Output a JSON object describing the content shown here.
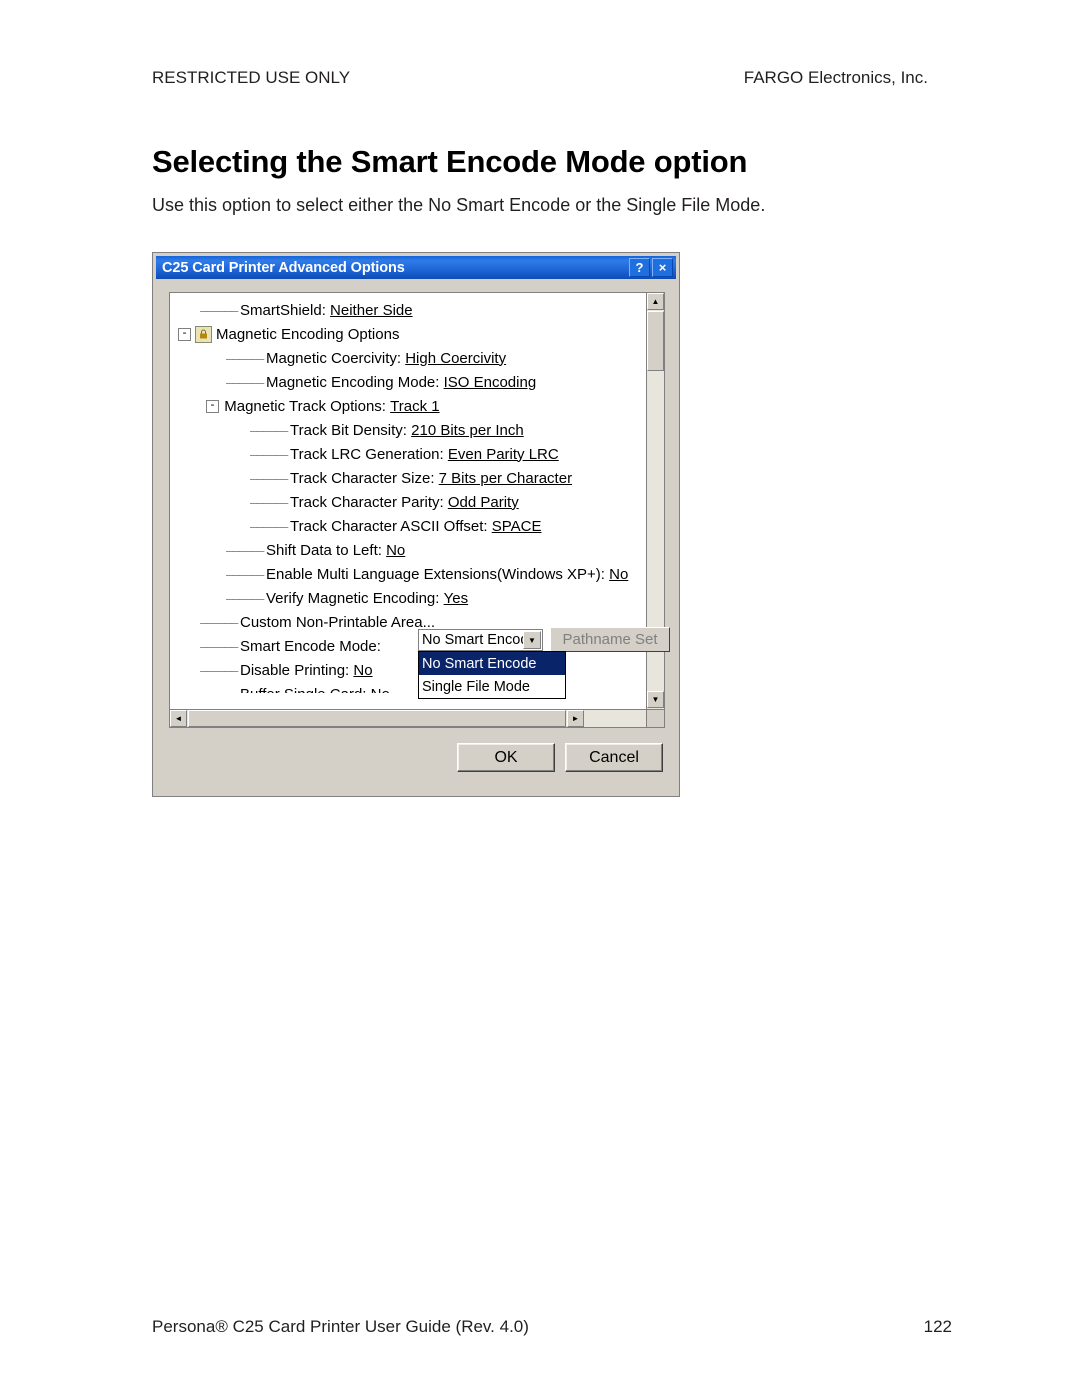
{
  "header": {
    "left": "RESTRICTED USE ONLY",
    "right": "FARGO Electronics, Inc."
  },
  "title": "Selecting the Smart Encode Mode option",
  "intro": "Use this option to select either the No Smart Encode or the Single File Mode.",
  "dialog": {
    "titlebar": "C25 Card Printer Advanced Options",
    "help_button": "?",
    "close_button": "×",
    "tree": [
      {
        "label": "SmartShield:",
        "value": "Neither Side",
        "indent": 30,
        "lead": "dashes",
        "expander": ""
      },
      {
        "label": "Magnetic Encoding Options",
        "value": "",
        "indent": 8,
        "lead": "expander-lock",
        "expander": "-"
      },
      {
        "label": "Magnetic Coercivity:",
        "value": "High Coercivity",
        "indent": 56,
        "lead": "dashes",
        "expander": ""
      },
      {
        "label": "Magnetic Encoding Mode:",
        "value": "ISO Encoding",
        "indent": 56,
        "lead": "dashes",
        "expander": ""
      },
      {
        "label": "Magnetic Track Options:",
        "value": "Track 1",
        "indent": 36,
        "lead": "expander",
        "expander": "-"
      },
      {
        "label": "Track Bit Density:",
        "value": "210 Bits per Inch",
        "indent": 80,
        "lead": "dashes",
        "expander": ""
      },
      {
        "label": "Track LRC Generation:",
        "value": "Even Parity LRC",
        "indent": 80,
        "lead": "dashes",
        "expander": ""
      },
      {
        "label": "Track Character Size:",
        "value": "7 Bits per Character",
        "indent": 80,
        "lead": "dashes",
        "expander": ""
      },
      {
        "label": "Track Character Parity:",
        "value": "Odd Parity",
        "indent": 80,
        "lead": "dashes",
        "expander": ""
      },
      {
        "label": "Track Character ASCII Offset:",
        "value": "SPACE",
        "indent": 80,
        "lead": "dashes",
        "expander": ""
      },
      {
        "label": "Shift Data to Left:",
        "value": "No",
        "indent": 56,
        "lead": "dashes",
        "expander": ""
      },
      {
        "label": "Enable Multi Language Extensions(Windows XP+):",
        "value": "No",
        "indent": 56,
        "lead": "dashes",
        "expander": ""
      },
      {
        "label": "Verify Magnetic Encoding:",
        "value": "Yes",
        "indent": 56,
        "lead": "dashes",
        "expander": ""
      },
      {
        "label": "Custom Non-Printable Area...",
        "value": "",
        "indent": 30,
        "lead": "dashes",
        "expander": ""
      },
      {
        "label": "Smart Encode Mode:",
        "value": "",
        "indent": 30,
        "lead": "dashes",
        "expander": ""
      },
      {
        "label": "Disable Printing:",
        "value": "No",
        "indent": 30,
        "lead": "dashes",
        "expander": ""
      },
      {
        "label": "Buffer Single Card:",
        "value": "No",
        "indent": 30,
        "lead": "dashes",
        "expander": ""
      }
    ],
    "combo": {
      "value": "No Smart Encod",
      "arrow": "▼"
    },
    "dropdown_options": [
      {
        "label": "No Smart Encode",
        "selected": true
      },
      {
        "label": "Single File Mode",
        "selected": false
      }
    ],
    "pathname_button": "Pathname Set",
    "ok_button": "OK",
    "cancel_button": "Cancel",
    "scroll": {
      "up": "▲",
      "down": "▼",
      "left": "◄",
      "right": "►"
    }
  },
  "footer": {
    "left": "Persona® C25 Card Printer User Guide (Rev.  4.0)",
    "page": "122"
  }
}
